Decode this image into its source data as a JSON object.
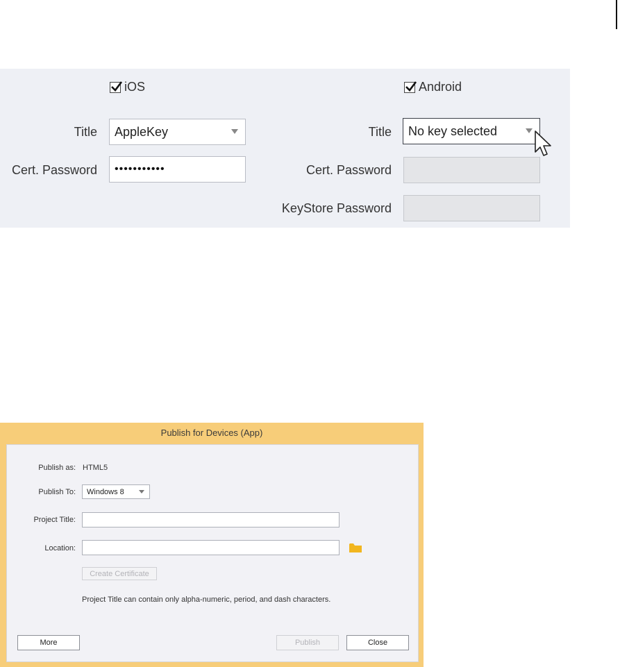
{
  "ios": {
    "checkbox_label": "iOS",
    "checked": true,
    "title_label": "Title",
    "title_value": "AppleKey",
    "password_label": "Cert. Password",
    "password_value": "•••••••••••"
  },
  "android": {
    "checkbox_label": "Android",
    "checked": true,
    "title_label": "Title",
    "title_value": "No key selected",
    "password_label": "Cert. Password",
    "keystore_label": "KeyStore Password"
  },
  "dialog": {
    "title": "Publish for Devices (App)",
    "publish_as_label": "Publish as:",
    "publish_as_value": "HTML5",
    "publish_to_label": "Publish To:",
    "publish_to_value": "Windows 8",
    "project_title_label": "Project Title:",
    "project_title_value": "",
    "location_label": "Location:",
    "location_value": "",
    "create_certificate_label": "Create Certificate",
    "hint": "Project Title can contain only alpha-numeric, period, and dash characters.",
    "more_label": "More",
    "publish_label": "Publish",
    "close_label": "Close"
  },
  "colors": {
    "dialog_frame": "#f7cd79",
    "folder_icon": "#f2b61f",
    "panel_bg": "#eef0f5"
  }
}
